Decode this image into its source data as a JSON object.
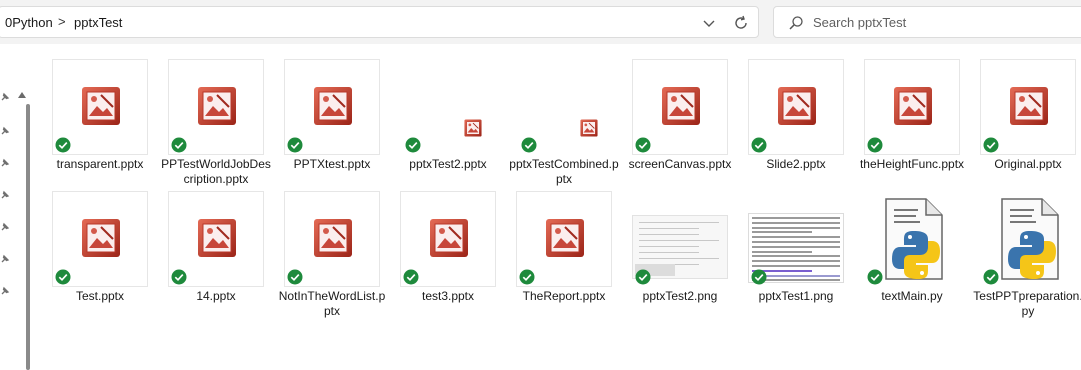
{
  "address_bar": {
    "crumbs": [
      "0Python",
      "pptxTest"
    ],
    "separator": ">"
  },
  "search": {
    "placeholder": "Search pptxTest"
  },
  "colors": {
    "check_green": "#1e8a3c",
    "ppt_red": "#c23b2b",
    "python_blue": "#3a74ad",
    "python_yellow": "#f5c518"
  },
  "files": [
    {
      "name": "transparent.pptx",
      "type": "pptx-big"
    },
    {
      "name": "PPTestWorldJobDescription.pptx",
      "type": "pptx-big"
    },
    {
      "name": "PPTXtest.pptx",
      "type": "pptx-big"
    },
    {
      "name": "pptxTest2.pptx",
      "type": "pptx-small"
    },
    {
      "name": "pptxTestCombined.pptx",
      "type": "pptx-small"
    },
    {
      "name": "screenCanvas.pptx",
      "type": "pptx-big"
    },
    {
      "name": "Slide2.pptx",
      "type": "pptx-big"
    },
    {
      "name": "theHeightFunc.pptx",
      "type": "pptx-big"
    },
    {
      "name": "Original.pptx",
      "type": "pptx-big"
    },
    {
      "name": "Test.pptx",
      "type": "pptx-big"
    },
    {
      "name": "14.pptx",
      "type": "pptx-big"
    },
    {
      "name": "NotInTheWordList.pptx",
      "type": "pptx-big"
    },
    {
      "name": "test3.pptx",
      "type": "pptx-big"
    },
    {
      "name": "TheReport.pptx",
      "type": "pptx-big"
    },
    {
      "name": "pptxTest2.png",
      "type": "png-shot"
    },
    {
      "name": "pptxTest1.png",
      "type": "png-doc"
    },
    {
      "name": "textMain.py",
      "type": "py"
    },
    {
      "name": "TestPPTpreparation.py",
      "type": "py"
    }
  ]
}
